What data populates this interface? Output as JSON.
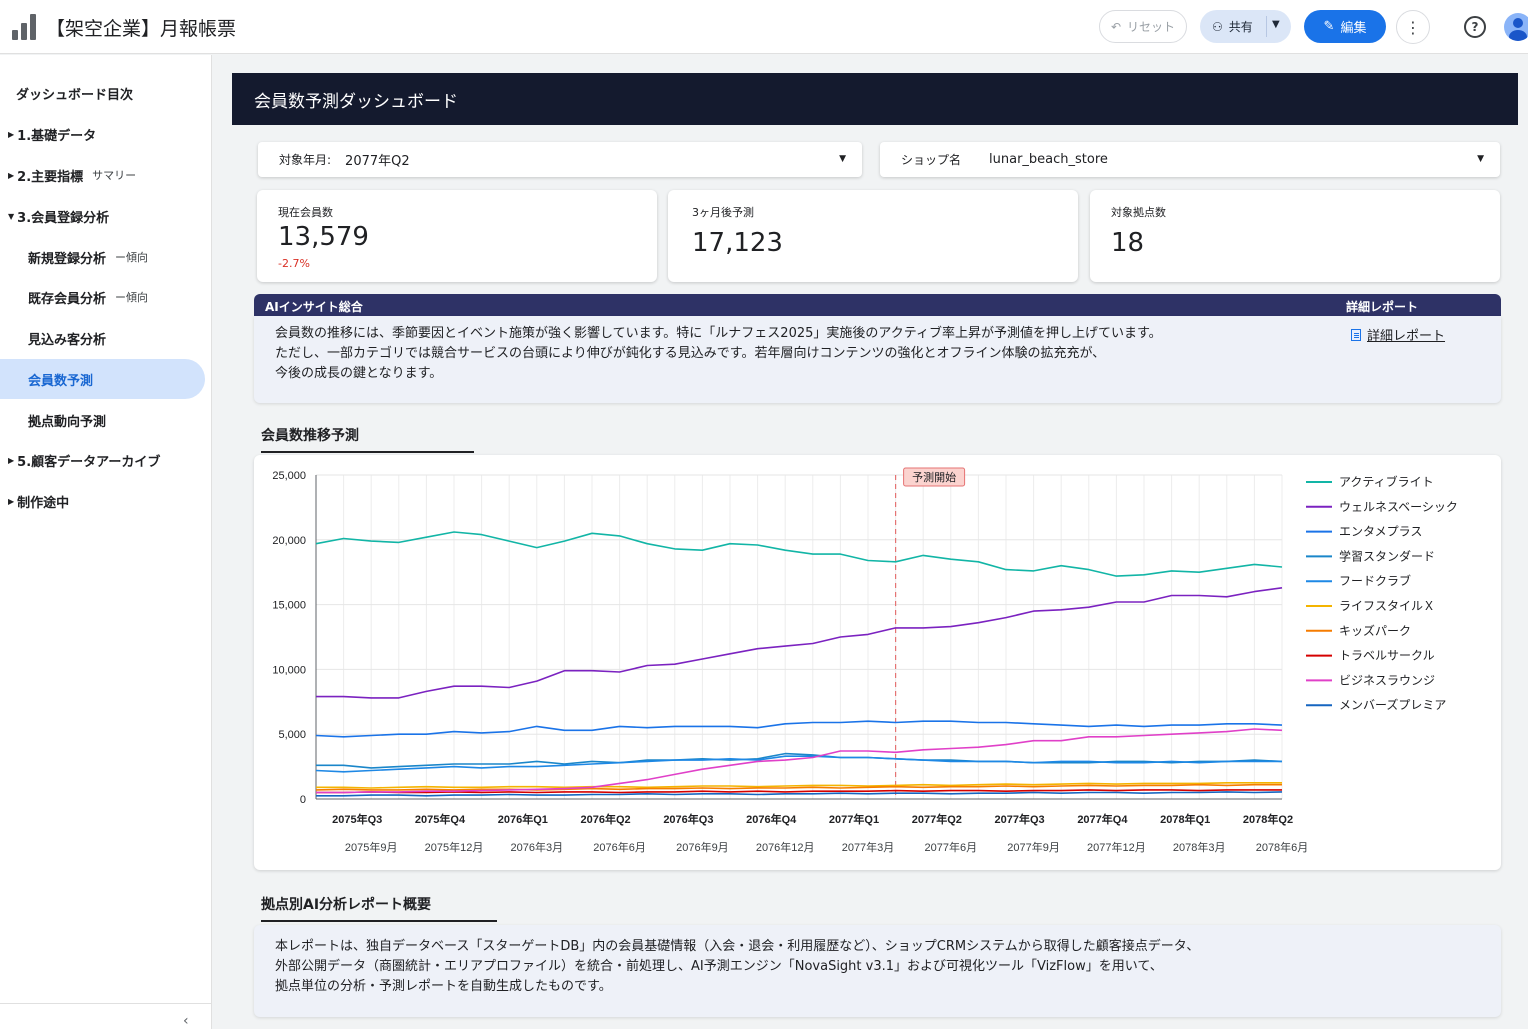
{
  "app": {
    "title": "【架空企業】月報帳票"
  },
  "toolbar": {
    "reset_label": "リセット",
    "share_label": "共有",
    "edit_label": "編集"
  },
  "sidebar": {
    "heading": "ダッシュボード目次",
    "items": [
      {
        "label": "1.基礎データ",
        "sub": ""
      },
      {
        "label": "2.主要指標",
        "sub": "サマリー"
      },
      {
        "label": "3.会員登録分析",
        "sub": ""
      },
      {
        "label": "新規登録分析",
        "sub": "ー傾向"
      },
      {
        "label": "既存会員分析",
        "sub": "ー傾向"
      },
      {
        "label": "見込み客分析",
        "sub": ""
      },
      {
        "label": "会員数予測",
        "sub": ""
      },
      {
        "label": "拠点動向予測",
        "sub": ""
      },
      {
        "label": "5.顧客データアーカイブ",
        "sub": ""
      },
      {
        "label": "制作途中",
        "sub": ""
      }
    ]
  },
  "page": {
    "title": "会員数予測ダッシュボード"
  },
  "filters": {
    "period_label": "対象年月:",
    "period_value": "2077年Q2",
    "shop_label": "ショップ名",
    "shop_value": "lunar_beach_store"
  },
  "kpis": [
    {
      "label": "現在会員数",
      "value": "13,579",
      "change": "-2.7%"
    },
    {
      "label": "3ヶ月後予測",
      "value": "17,123"
    },
    {
      "label": "対象拠点数",
      "value": "18"
    }
  ],
  "insight": {
    "header": "AIインサイト総合",
    "header_right": "詳細レポート",
    "lines": [
      "会員数の推移には、季節要因とイベント施策が強く影響しています。特に「ルナフェス2025」実施後のアクティブ率上昇が予測値を押し上げています。",
      "ただし、一部カテゴリでは競合サービスの台頭により伸びが鈍化する見込みです。若年層向けコンテンツの強化とオフライン体験の拡充充が、",
      "今後の成長の鍵となります。"
    ],
    "link_label": "詳細レポート"
  },
  "chart_section_title": "会員数推移予測",
  "chart_data": {
    "type": "line",
    "x": [
      "2075-07",
      "2075-08",
      "2075-09",
      "2075-10",
      "2075-11",
      "2075-12",
      "2076-01",
      "2076-02",
      "2076-03",
      "2076-04",
      "2076-05",
      "2076-06",
      "2076-07",
      "2076-08",
      "2076-09",
      "2076-10",
      "2076-11",
      "2076-12",
      "2077-01",
      "2077-02",
      "2077-03",
      "2077-04",
      "2077-05",
      "2077-06",
      "2077-07",
      "2077-08",
      "2077-09",
      "2077-10",
      "2077-11",
      "2077-12",
      "2078-01",
      "2078-02",
      "2078-03",
      "2078-04",
      "2078-05",
      "2078-06"
    ],
    "quarter_ticks": [
      "2075年Q3",
      "2075年Q4",
      "2076年Q1",
      "2076年Q2",
      "2076年Q3",
      "2076年Q4",
      "2077年Q1",
      "2077年Q2",
      "2077年Q3",
      "2077年Q4",
      "2078年Q1",
      "2078年Q2"
    ],
    "month_ticks": [
      "2075年9月",
      "2075年12月",
      "2076年3月",
      "2076年6月",
      "2076年9月",
      "2076年12月",
      "2077年3月",
      "2077年6月",
      "2077年9月",
      "2077年12月",
      "2078年3月",
      "2078年6月"
    ],
    "ylim": [
      0,
      25000
    ],
    "yticks": [
      0,
      5000,
      10000,
      15000,
      20000,
      25000
    ],
    "ytick_labels": [
      "0",
      "5,000",
      "10,000",
      "15,000",
      "20,000",
      "25,000"
    ],
    "grid": true,
    "legend_position": "right",
    "forecast_start_label": "予測開始",
    "forecast_start_x": "2077-04",
    "series": [
      {
        "name": "アクティブライト",
        "color": "#12b5a6",
        "values": [
          19700,
          20100,
          19900,
          19800,
          20200,
          20600,
          20400,
          19900,
          19400,
          19900,
          20500,
          20300,
          19700,
          19300,
          19200,
          19700,
          19600,
          19200,
          18900,
          18900,
          18400,
          18300,
          18800,
          18500,
          18300,
          17700,
          17600,
          18000,
          17700,
          17200,
          17300,
          17600,
          17500,
          17800,
          18100,
          17900
        ]
      },
      {
        "name": "ウェルネスベーシック",
        "color": "#7b22c0",
        "values": [
          7900,
          7900,
          7800,
          7800,
          8300,
          8700,
          8700,
          8600,
          9100,
          9900,
          9900,
          9800,
          10300,
          10400,
          10800,
          11200,
          11600,
          11800,
          12000,
          12500,
          12700,
          13200,
          13200,
          13300,
          13600,
          14000,
          14500,
          14600,
          14800,
          15200,
          15200,
          15700,
          15700,
          15600,
          16000,
          16300
        ]
      },
      {
        "name": "エンタメプラス",
        "color": "#1a73e8",
        "values": [
          4900,
          4800,
          4900,
          5000,
          5000,
          5200,
          5100,
          5200,
          5600,
          5300,
          5300,
          5600,
          5500,
          5600,
          5600,
          5600,
          5500,
          5800,
          5900,
          5900,
          6000,
          5900,
          6000,
          6000,
          5900,
          5900,
          5800,
          5700,
          5600,
          5700,
          5600,
          5700,
          5700,
          5800,
          5800,
          5700
        ]
      },
      {
        "name": "学習スタンダード",
        "color": "#1a86c9",
        "values": [
          2600,
          2600,
          2400,
          2500,
          2600,
          2700,
          2700,
          2700,
          2900,
          2700,
          2900,
          2800,
          3000,
          3000,
          3100,
          3000,
          3100,
          3500,
          3400,
          3200,
          3200,
          3100,
          3000,
          3000,
          2900,
          2900,
          2800,
          2800,
          2800,
          2900,
          2900,
          2800,
          2900,
          2900,
          3000,
          2900
        ]
      },
      {
        "name": "フードクラブ",
        "color": "#1e88e5",
        "values": [
          2200,
          2100,
          2200,
          2300,
          2400,
          2500,
          2400,
          2500,
          2500,
          2600,
          2700,
          2800,
          2900,
          3000,
          3000,
          3100,
          3000,
          3300,
          3300,
          3200,
          3200,
          3100,
          3000,
          2900,
          2900,
          2900,
          2800,
          2900,
          2900,
          2800,
          2800,
          2900,
          2800,
          2900,
          2900,
          2900
        ]
      },
      {
        "name": "ライフスタイルＸ",
        "color": "#f4b400",
        "values": [
          900,
          900,
          850,
          900,
          950,
          900,
          900,
          950,
          950,
          900,
          950,
          950,
          900,
          950,
          1000,
          1000,
          950,
          1000,
          1050,
          1050,
          1000,
          1050,
          1100,
          1050,
          1100,
          1150,
          1100,
          1150,
          1200,
          1150,
          1200,
          1200,
          1200,
          1250,
          1250,
          1250
        ]
      },
      {
        "name": "キッズパーク",
        "color": "#f57c00",
        "values": [
          700,
          750,
          700,
          700,
          750,
          700,
          750,
          750,
          700,
          750,
          800,
          750,
          800,
          800,
          850,
          800,
          850,
          850,
          900,
          850,
          900,
          950,
          900,
          950,
          950,
          1000,
          950,
          1000,
          1050,
          1000,
          1050,
          1050,
          1100,
          1050,
          1100,
          1100
        ]
      },
      {
        "name": "トラベルサークル",
        "color": "#d50000",
        "values": [
          500,
          500,
          550,
          500,
          500,
          550,
          500,
          550,
          500,
          550,
          550,
          500,
          550,
          550,
          600,
          550,
          600,
          550,
          600,
          600,
          600,
          650,
          600,
          650,
          650,
          600,
          650,
          650,
          700,
          650,
          700,
          700,
          650,
          700,
          700,
          700
        ]
      },
      {
        "name": "ビジネスラウンジ",
        "color": "#e040c8",
        "values": [
          500,
          500,
          550,
          550,
          600,
          600,
          650,
          700,
          750,
          800,
          900,
          1200,
          1500,
          1900,
          2300,
          2600,
          2900,
          3000,
          3200,
          3700,
          3700,
          3600,
          3800,
          3900,
          4000,
          4200,
          4500,
          4500,
          4800,
          4800,
          4900,
          5000,
          5100,
          5200,
          5400,
          5300
        ]
      },
      {
        "name": "メンバーズプレミア",
        "color": "#1565c0",
        "values": [
          250,
          250,
          300,
          300,
          250,
          300,
          300,
          350,
          300,
          300,
          350,
          350,
          400,
          350,
          400,
          400,
          350,
          400,
          400,
          450,
          400,
          450,
          450,
          400,
          450,
          450,
          500,
          450,
          500,
          500,
          450,
          500,
          500,
          550,
          500,
          550
        ]
      }
    ]
  },
  "summary": {
    "title": "拠点別AI分析レポート概要",
    "lines": [
      "本レポートは、独自データベース「スターゲートDB」内の会員基礎情報（入会・退会・利用履歴など）、ショップCRMシステムから取得した顧客接点データ、",
      "外部公開データ（商圏統計・エリアプロファイル）を統合・前処理し、AI予測エンジン「NovaSight v3.1」および可視化ツール「VizFlow」を用いて、",
      "拠点単位の分析・予測レポートを自動生成したものです。"
    ]
  }
}
